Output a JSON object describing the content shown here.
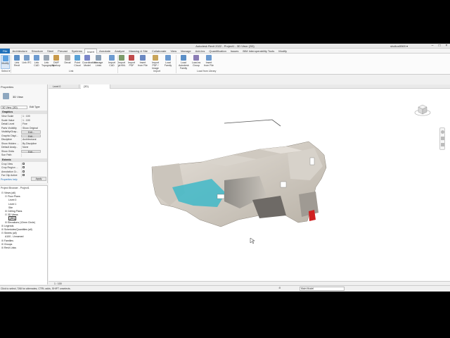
{
  "window": {
    "title": "Autodesk Revit 2022 - Project1 - 3D View: {3D}",
    "user": "sholton5569 ▾"
  },
  "tabs": [
    "File",
    "Architecture",
    "Structure",
    "Steel",
    "Precast",
    "Systems",
    "Insert",
    "Annotate",
    "Analyze",
    "Massing & Site",
    "Collaborate",
    "View",
    "Manage",
    "Add-Ins",
    "Quantification",
    "Issues",
    "BIM Interoperability Tools",
    "Modify"
  ],
  "ribbon": {
    "modify": "Modify",
    "buttons": [
      "Link Revit",
      "Link IFC",
      "Link CAD",
      "Link Topography",
      "DWF Markup",
      "Decal",
      "Point Cloud",
      "Coordination Model",
      "Manage Links",
      "Import CAD",
      "Import gbXML",
      "Import PDF",
      "Insert from File",
      "Import PDF / Image",
      "Load Family",
      "Load Autodesk Family",
      "Load as Group",
      "Insert from File"
    ],
    "panels": {
      "select": "Select ▾",
      "link": "Link",
      "import": "Import",
      "load": "Load from Library"
    }
  },
  "properties": {
    "title": "Properties",
    "type": "3D View",
    "selector": "3D View: {3D}",
    "edit_type": "Edit Type",
    "graphics_header": "Graphics",
    "rows": [
      {
        "k": "View Scale",
        "v": "1 : 100"
      },
      {
        "k": "Scale Value",
        "v": "1 : 100"
      },
      {
        "k": "Detail Level",
        "v": "Fine"
      },
      {
        "k": "Parts Visibility",
        "v": "Show Original"
      },
      {
        "k": "Visibility/Grap...",
        "v": "Edit..."
      },
      {
        "k": "Graphic Displ...",
        "v": "Edit..."
      },
      {
        "k": "Discipline",
        "v": "Architectural"
      },
      {
        "k": "Show Hidden ...",
        "v": "By Discipline"
      },
      {
        "k": "Default Analy...",
        "v": "None"
      },
      {
        "k": "Show Grids",
        "v": "Edit..."
      },
      {
        "k": "Sun Path",
        "v": ""
      }
    ],
    "extents_header": "Extents",
    "extents": [
      "Crop View",
      "Crop Region ...",
      "Annotation Cr...",
      "Far Clip Active"
    ],
    "help": "Properties help",
    "apply": "Apply"
  },
  "browser": {
    "title": "Project Browser - Project1",
    "items": [
      {
        "t": "Views (all)",
        "lvl": 0,
        "tg": "⊟"
      },
      {
        "t": "Floor Plans",
        "lvl": 1,
        "tg": "⊟"
      },
      {
        "t": "Level 0",
        "lvl": 2,
        "tg": ""
      },
      {
        "t": "Level 1",
        "lvl": 2,
        "tg": ""
      },
      {
        "t": "Site",
        "lvl": 2,
        "tg": ""
      },
      {
        "t": "Ceiling Plans",
        "lvl": 1,
        "tg": "⊞"
      },
      {
        "t": "3D Views",
        "lvl": 1,
        "tg": "⊟"
      },
      {
        "t": "{3D}",
        "lvl": 2,
        "tg": ""
      },
      {
        "t": "Elevations (12mm Circle)",
        "lvl": 1,
        "tg": "⊞"
      },
      {
        "t": "Legends",
        "lvl": 0,
        "tg": "⊞"
      },
      {
        "t": "Schedules/Quantities (all)",
        "lvl": 0,
        "tg": "⊞"
      },
      {
        "t": "Sheets (all)",
        "lvl": 0,
        "tg": "⊟"
      },
      {
        "t": "A100 - Unnamed",
        "lvl": 1,
        "tg": ""
      },
      {
        "t": "Families",
        "lvl": 0,
        "tg": "⊞"
      },
      {
        "t": "Groups",
        "lvl": 0,
        "tg": "⊞"
      },
      {
        "t": "Revit Links",
        "lvl": 0,
        "tg": "⊞"
      }
    ]
  },
  "view_tabs": [
    "Level 0",
    "{3D}"
  ],
  "viewbar": {
    "scale": "1 : 100"
  },
  "status": {
    "message": "Click to select, TAB for alternates, CTRL adds, SHIFT unselects.",
    "model": "Main Model",
    "zoom": ":0"
  },
  "colors": {
    "accent": "#1e6fb9",
    "cyan_room": "#3fb8c8",
    "red_door": "#d02020"
  }
}
